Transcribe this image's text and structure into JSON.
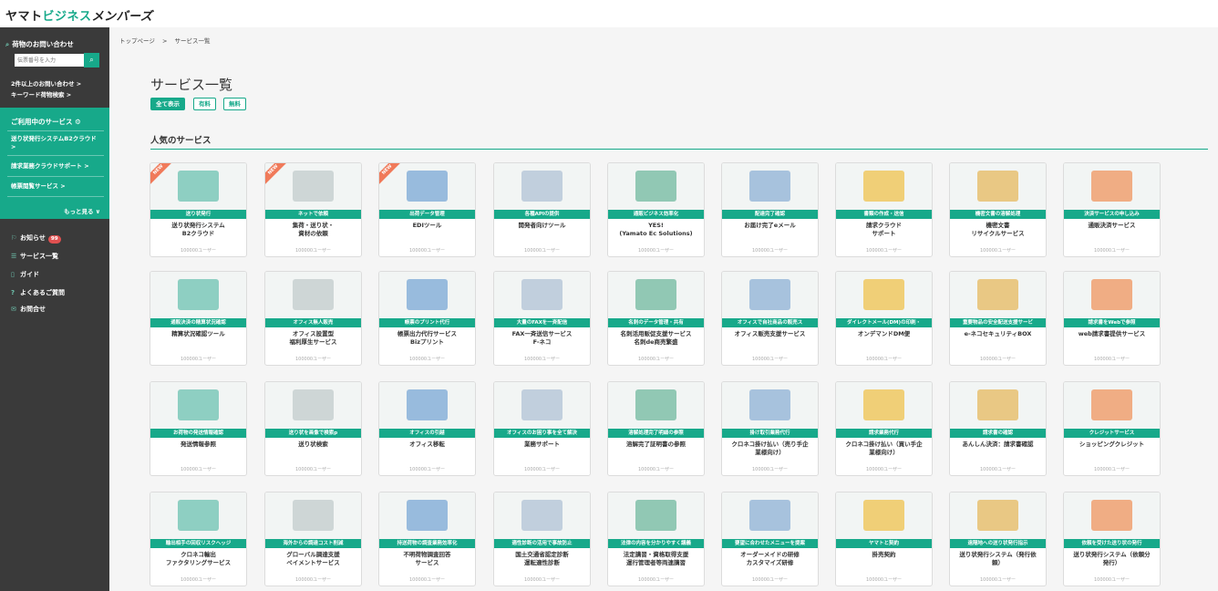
{
  "header": {
    "logo_part1": "ヤマト",
    "logo_part2": "ビジネス",
    "logo_part3": "メンバーズ"
  },
  "sidebar": {
    "search_title": "荷物のお問い合わせ",
    "search_placeholder": "伝票番号を入力",
    "link1": "2件以上のお問い合わせ >",
    "link2": "キーワード荷物検索 >",
    "using_title": "ご利用中のサービス",
    "using_items": [
      "送り状発行システムB2クラウド >",
      "請求業務クラウドサポート >",
      "帳票閲覧サービス >"
    ],
    "more": "もっと見る ∨",
    "nav": [
      {
        "label": "お知らせ",
        "badge": "99"
      },
      {
        "label": "サービス一覧"
      },
      {
        "label": "ガイド"
      },
      {
        "label": "よくあるご質問"
      },
      {
        "label": "お問合せ"
      }
    ]
  },
  "breadcrumb": {
    "home": "トップページ",
    "sep": ">",
    "current": "サービス一覧"
  },
  "page_title": "サービス一覧",
  "filters": [
    "全て表示",
    "有料",
    "無料"
  ],
  "section_title": "人気のサービス",
  "cards": [
    {
      "cat": "送り状発行",
      "name": "送り状発行システム\nB2クラウド",
      "users": "100000ユーザー",
      "new": "NEW"
    },
    {
      "cat": "ネットで依頼",
      "name": "集荷・送り状・\n資材の依頼",
      "users": "100000ユーザー",
      "new": "NEW"
    },
    {
      "cat": "出荷データ管理",
      "name": "EDIツール",
      "users": "100000ユーザー",
      "new": "NEW"
    },
    {
      "cat": "各種APIの提供",
      "name": "開発者向けツール",
      "users": "100000ユーザー"
    },
    {
      "cat": "通販ビジネス効率化",
      "name": "YES!\n(Yamato Ec Solutions)",
      "users": "100000ユーザー"
    },
    {
      "cat": "配達完了確認",
      "name": "お届け完了eメール",
      "users": "100000ユーザー"
    },
    {
      "cat": "書類の作成・送信",
      "name": "請求クラウド\nサポート",
      "users": "100000ユーザー"
    },
    {
      "cat": "機密文書の溶解処理",
      "name": "機密文書\nリサイクルサービス",
      "users": "100000ユーザー"
    },
    {
      "cat": "決済サービスの申し込み",
      "name": "通販決済サービス",
      "users": "100000ユーザー"
    },
    {
      "cat": "通販決済の精算状況確認",
      "name": "精算状況確認ツール",
      "users": "100000ユーザー"
    },
    {
      "cat": "オフィス無人販売",
      "name": "オフィス設置型\n福利厚生サービス",
      "users": "100000ユーザー"
    },
    {
      "cat": "帳票のプリント代行",
      "name": "帳票出力代行サービス\nBizプリント",
      "users": "100000ユーザー"
    },
    {
      "cat": "大量のFAXを一斉配信",
      "name": "FAX一斉送信サービス\nF-ネコ",
      "users": "100000ユーザー"
    },
    {
      "cat": "名刺のデータ管理・共有",
      "name": "名刺活用販促支援サービス\n名刺de商売繁盛",
      "users": "100000ユーザー"
    },
    {
      "cat": "オフィスで自社商品の販売ス",
      "name": "オフィス販売支援サービス",
      "users": "100000ユーザー"
    },
    {
      "cat": "ダイレクトメール(DM)の印刷・\n印字・配送",
      "name": "オンデマンドDM便",
      "users": "100000ユーザー"
    },
    {
      "cat": "重要物品の安全配送支援サービ\nス",
      "name": "e-ネコセキュリティBOX",
      "users": "100000ユーザー"
    },
    {
      "cat": "請求書をWebで参照",
      "name": "web請求書提供サービス",
      "users": "100000ユーザー"
    },
    {
      "cat": "お荷物の発送情報確認",
      "name": "発送情報参照",
      "users": "100000ユーザー"
    },
    {
      "cat": "送り状を画像で検索p",
      "name": "送り状検索",
      "users": "100000ユーザー"
    },
    {
      "cat": "オフィスの引越",
      "name": "オフィス移転",
      "users": "100000ユーザー"
    },
    {
      "cat": "オフィスのお困り事を全て解決",
      "name": "業務サポート",
      "users": "100000ユーザー"
    },
    {
      "cat": "溶解処理完了明細の参照",
      "name": "溶解完了証明書の参照",
      "users": "100000ユーザー"
    },
    {
      "cat": "掛け取引業務代行",
      "name": "クロネコ掛け払い（売り手企\n業様向け）",
      "users": "100000ユーザー"
    },
    {
      "cat": "請求業務代行",
      "name": "クロネコ掛け払い（買い手企\n業様向け）",
      "users": "100000ユーザー"
    },
    {
      "cat": "請求書の確認",
      "name": "あんしん決済：請求書確認",
      "users": "100000ユーザー"
    },
    {
      "cat": "クレジットサービス",
      "name": "ショッピングクレジット",
      "users": "100000ユーザー"
    },
    {
      "cat": "輸出相手の回収リスクヘッジ",
      "name": "クロネコ輸出\nファクタリングサービス",
      "users": "100000ユーザー"
    },
    {
      "cat": "海外からの調達コスト削減",
      "name": "グローバル調達支援\nペイメントサービス",
      "users": "100000ユーザー"
    },
    {
      "cat": "持送荷物の調査業務効率化",
      "name": "不明荷物調査回答\nサービス",
      "users": "100000ユーザー"
    },
    {
      "cat": "適性診断の活用で事故防止",
      "name": "国土交通省認定診断\n運転適性診断",
      "users": "100000ユーザー"
    },
    {
      "cat": "法律の内容を分かりやすく講義",
      "name": "法定講習・資格取得支援\n運行管理者等両連講習",
      "users": "100000ユーザー"
    },
    {
      "cat": "要望に合わせたメニューを提案",
      "name": "オーダーメイドの研修\nカスタマイズ研修",
      "users": "100000ユーザー"
    },
    {
      "cat": "ヤマトと契約",
      "name": "掛売契約",
      "users": "100000ユーザー"
    },
    {
      "cat": "遠隔地への送り状発行指示",
      "name": "送り状発行システム（発行依\n頼）",
      "users": "100000ユーザー"
    },
    {
      "cat": "依頼を受けた送り状の発行",
      "name": "送り状発行システム（依頼分\n発行）",
      "users": "100000ユーザー"
    }
  ],
  "colors": {
    "accent": "#17a98a",
    "sidebar": "#3a3a3a",
    "new_ribbon": "#f07a5a"
  }
}
